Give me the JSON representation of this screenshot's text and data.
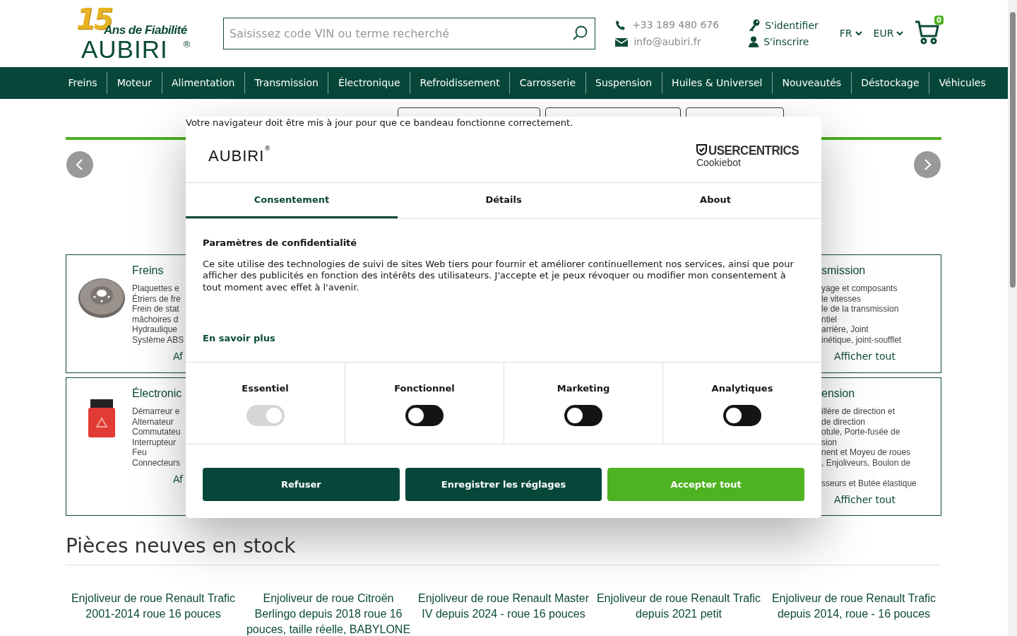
{
  "header": {
    "logo": {
      "badge": "15",
      "tagline": "Ans de Fiabilité",
      "brand": "AUBIRI",
      "mark": "®"
    },
    "search": {
      "placeholder": "Saisissez code VIN ou terme recherché"
    },
    "contact": [
      {
        "kind": "phone",
        "text": "+33 189 480 676"
      },
      {
        "kind": "email",
        "text": "info@aubiri.fr"
      }
    ],
    "account": [
      {
        "kind": "key",
        "text": "S'identifier"
      },
      {
        "kind": "user",
        "text": "S'inscrire"
      }
    ],
    "language": "FR",
    "currency": "EUR",
    "cart_count": "0"
  },
  "nav": [
    "Freins",
    "Moteur",
    "Alimentation",
    "Transmission",
    "Électronique",
    "Refroidissement",
    "Carrosserie",
    "Suspension",
    "Huiles & Universel",
    "Nouveautés",
    "Déstockage",
    "Véhicules"
  ],
  "categories_left": [
    {
      "title": "Freins",
      "kind": "picture",
      "items": [
        "Plaquettes e",
        "Étriers de fre",
        "Frein de stat",
        "mâchoires d",
        "Hydraulique",
        "Système ABS"
      ],
      "link": "Af"
    },
    {
      "title": "Électronic",
      "kind": "picture",
      "items": [
        "Démarreur e",
        "Alternateur",
        "Commutateu",
        "Interrupteur",
        "Feu",
        "Connecteurs"
      ],
      "link": "Af"
    }
  ],
  "categories_right": [
    {
      "title": "smission",
      "items": [
        "yage et composants",
        "le vitesses",
        "le de la transmission",
        "ntiel",
        "arrière, Joint",
        "inétique, joint-soufflet"
      ],
      "link": "Afficher tout"
    },
    {
      "title": "ension",
      "items": [
        "illère de direction et",
        "de direction",
        "otule, Porte-fusée de",
        "sion",
        "nent et Moyeu de roues",
        ", Enjoliveurs, Boulon de",
        "sseurs et Butée élastique"
      ],
      "link": "Afficher tout"
    }
  ],
  "stock": {
    "title": "Pièces neuves en stock",
    "products": [
      "Enjoliveur de roue Renault Trafic 2001-2014 roue 16 pouces",
      "Enjoliveur de roue Citroën Berlingo depuis 2018 roue 16 pouces, taille réelle, BABYLONE",
      "Enjoliveur de roue Renault Master IV depuis 2024 - roue 16 pouces",
      "Enjoliveur de roue Renault Trafic depuis 2021 petit",
      "Enjoliveur de roue Renault Trafic depuis 2014, roue - 16 pouces"
    ]
  },
  "cookie_dialog": {
    "notice": "Votre navigateur doit être mis à jour pour que ce bandeau fonctionne correctement.",
    "logo": "AUBIRI",
    "logo_mark": "®",
    "provider": {
      "name": "USERCENTRICS",
      "product": "Cookiebot"
    },
    "tabs": [
      {
        "label": "Consentement",
        "selected": true
      },
      {
        "label": "Détails",
        "selected": false
      },
      {
        "label": "About",
        "selected": false
      }
    ],
    "heading": "Paramètres de confidentialité",
    "body": "Ce site utilise des technologies de suivi de sites Web tiers pour fournir et améliorer continuellement nos services, ainsi que pour afficher des publicités en fonction des intérêts des utilisateurs. J'accepte et je peux révoquer ou modifier mon consentement à tout moment avec effet à l'avenir.",
    "link": "En savoir plus",
    "toggles": [
      {
        "label": "Essentiel",
        "on": true,
        "disabled": true
      },
      {
        "label": "Fonctionnel",
        "on": false,
        "disabled": false
      },
      {
        "label": "Marketing",
        "on": false,
        "disabled": false
      },
      {
        "label": "Analytiques",
        "on": false,
        "disabled": false
      }
    ],
    "buttons": [
      {
        "label": "Refuser",
        "kind": "secondary"
      },
      {
        "label": "Enregistrer les réglages",
        "kind": "secondary"
      },
      {
        "label": "Accepter tout",
        "kind": "primary"
      }
    ]
  }
}
